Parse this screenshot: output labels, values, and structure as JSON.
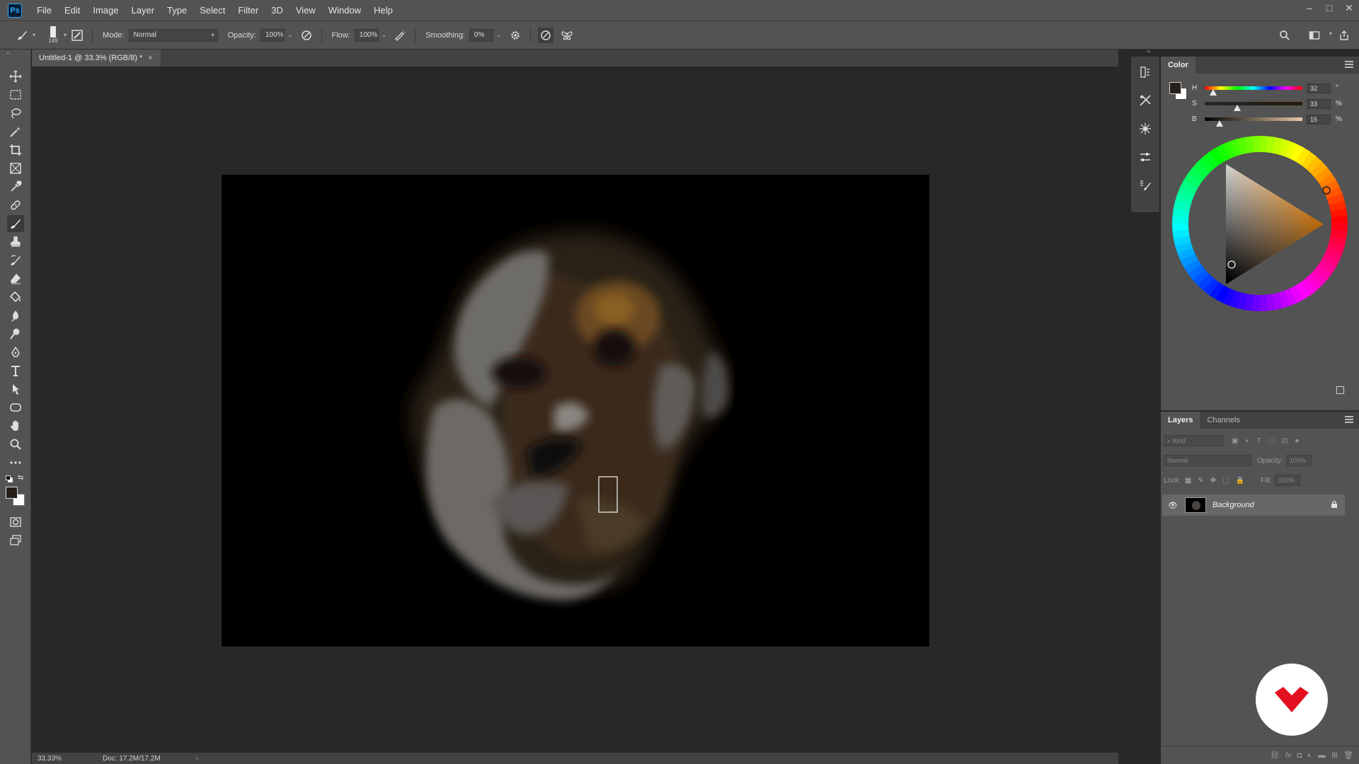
{
  "app": {
    "logo_text": "Ps"
  },
  "menu": [
    "File",
    "Edit",
    "Image",
    "Layer",
    "Type",
    "Select",
    "Filter",
    "3D",
    "View",
    "Window",
    "Help"
  ],
  "window_controls": {
    "minimize": "–",
    "maximize": "□",
    "close": "✕"
  },
  "options": {
    "brush_size": "149",
    "mode_label": "Mode:",
    "mode_value": "Normal",
    "opacity_label": "Opacity:",
    "opacity_value": "100%",
    "flow_label": "Flow:",
    "flow_value": "100%",
    "smoothing_label": "Smoothing:",
    "smoothing_value": "0%"
  },
  "document": {
    "tab_title": "Untitled-1 @ 33.3% (RGB/8) *",
    "close_glyph": "×"
  },
  "status": {
    "zoom": "33.33%",
    "doc_info": "Doc: 17.2M/17.2M",
    "arrow": "›"
  },
  "color_panel": {
    "tab": "Color",
    "h_label": "H",
    "h_value": "32",
    "h_unit": "°",
    "s_label": "S",
    "s_value": "33",
    "s_unit": "%",
    "b_label": "B",
    "b_value": "15",
    "b_unit": "%",
    "foreground_color": "#261f1a",
    "background_color": "#ffffff"
  },
  "layers_panel": {
    "tabs": [
      "Layers",
      "Channels"
    ],
    "filter_placeholder": "Kind",
    "blend_mode": "Normal",
    "opacity_label": "Opacity:",
    "opacity_value": "100%",
    "lock_label": "Lock:",
    "fill_label": "Fill:",
    "fill_value": "100%",
    "layers": [
      {
        "name": "Background",
        "visible": true,
        "locked": true
      }
    ],
    "footer_icons": [
      "link-icon",
      "fx-icon",
      "mask-icon",
      "adjustment-icon",
      "group-icon",
      "new-layer-icon",
      "trash-icon"
    ],
    "fx_text": "fx"
  },
  "accent_colors": {
    "ps_blue": "#31a8ff",
    "watermark_red": "#e3101f"
  }
}
